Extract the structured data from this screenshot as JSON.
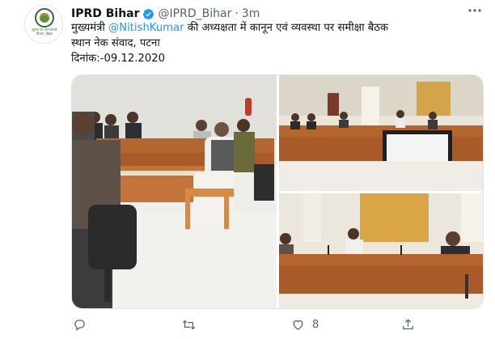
{
  "tweet": {
    "display_name": "IPRD Bihar",
    "handle": "@IPRD_Bihar",
    "separator": "·",
    "time": "3m",
    "text_before_mention": "मुख्यमंत्री ",
    "mention": "@NitishKumar",
    "text_after_mention": " की अध्यक्षता में कानून एवं व्यवस्था पर समीक्षा बैठक",
    "line2": "स्थान नेक संवाद, पटना",
    "line3": "दिनांक:-09.12.2020",
    "avatar_logo_text": "सूचना एवं जन-सम्पर्क विभाग, बिहार",
    "like_count": "8"
  },
  "icons": {
    "verified": "verified-badge-icon",
    "more": "more-options-icon",
    "reply": "reply-icon",
    "retweet": "retweet-icon",
    "like": "heart-icon",
    "share": "share-icon"
  },
  "colors": {
    "accent": "#1d9bf0",
    "secondary_text": "#536471",
    "wall": "#e9e4d8",
    "table_wood": "#b5652e"
  }
}
